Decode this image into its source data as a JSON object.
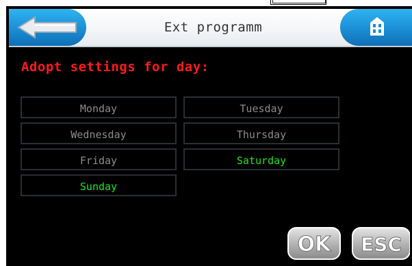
{
  "header": {
    "title": "Ext programm",
    "back_icon": "arrow-left-icon",
    "home_icon": "home-icon"
  },
  "main": {
    "section_label": "Adopt settings for day:",
    "days": [
      {
        "label": "Monday",
        "selected": false
      },
      {
        "label": "Tuesday",
        "selected": false
      },
      {
        "label": "Wednesday",
        "selected": false
      },
      {
        "label": "Thursday",
        "selected": false
      },
      {
        "label": "Friday",
        "selected": false
      },
      {
        "label": "Saturday",
        "selected": true
      },
      {
        "label": "Sunday",
        "selected": true
      }
    ]
  },
  "footer": {
    "ok_label": "OK",
    "esc_label": "ESC"
  },
  "colors": {
    "accent_blue": "#1a8ed6",
    "section_label": "#ff1a1a",
    "day_active": "#1fe61f",
    "day_inactive": "#8c8c8c"
  }
}
